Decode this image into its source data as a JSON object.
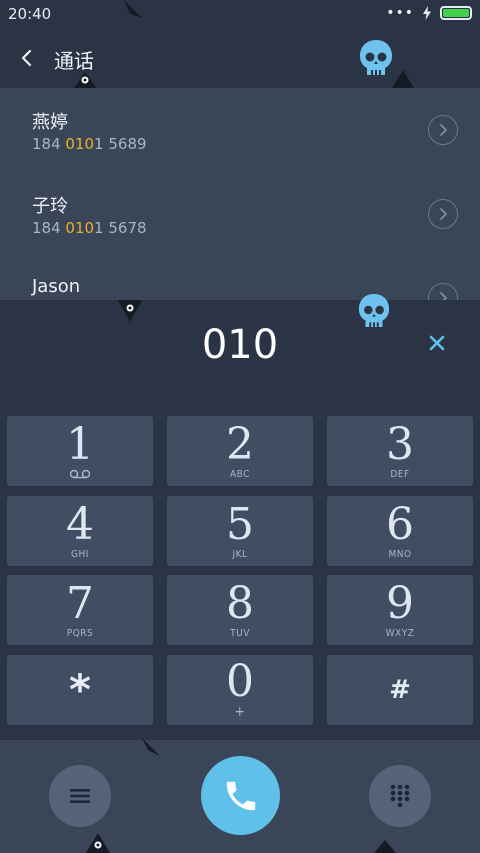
{
  "status_bar": {
    "time": "20:40",
    "dots": "•••",
    "battery_level": 1.0,
    "battery_color": "#43d14a"
  },
  "header": {
    "title": "通话"
  },
  "contacts": [
    {
      "name": "燕婷",
      "number_prefix": "184 ",
      "number_match": "010",
      "number_suffix": "1 5689"
    },
    {
      "name": "子玲",
      "number_prefix": "184 ",
      "number_match": "010",
      "number_suffix": "1 5678"
    },
    {
      "name": "Jason",
      "number_prefix": "",
      "number_match": "",
      "number_suffix": ""
    }
  ],
  "dialer": {
    "input_value": "010"
  },
  "keypad": [
    {
      "digit": "1",
      "sub": ""
    },
    {
      "digit": "2",
      "sub": "ABC"
    },
    {
      "digit": "3",
      "sub": "DEF"
    },
    {
      "digit": "4",
      "sub": "GHI"
    },
    {
      "digit": "5",
      "sub": "JKL"
    },
    {
      "digit": "6",
      "sub": "MNO"
    },
    {
      "digit": "7",
      "sub": "PQRS"
    },
    {
      "digit": "8",
      "sub": "TUV"
    },
    {
      "digit": "9",
      "sub": "WXYZ"
    },
    {
      "digit": "*",
      "sub": ""
    },
    {
      "digit": "0",
      "sub": "+"
    },
    {
      "digit": "#",
      "sub": ""
    }
  ],
  "colors": {
    "accent": "#5fc1ea",
    "highlight": "#e7b12e",
    "background": "#2b3444",
    "key": "#414d62"
  },
  "icons": {
    "back": "chevron-left-icon",
    "clear": "close-icon",
    "menu": "menu-icon",
    "call": "phone-icon",
    "keypad_toggle": "dialpad-icon",
    "voicemail": "voicemail-icon"
  }
}
